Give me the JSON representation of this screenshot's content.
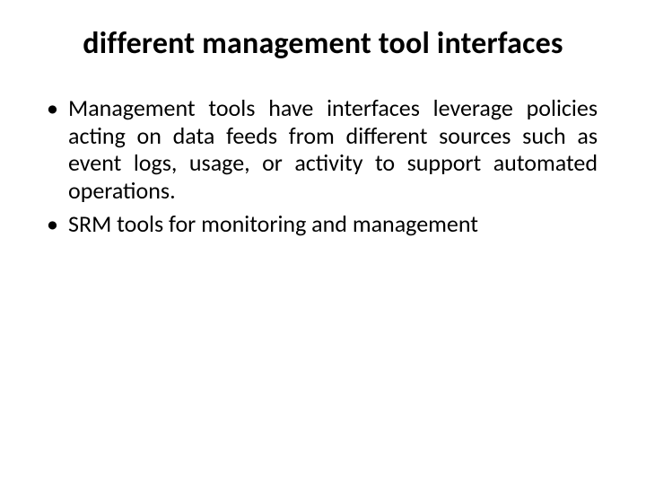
{
  "slide": {
    "title": "different management tool interfaces",
    "bullets": [
      "Management tools have interfaces leverage policies acting on data feeds from different sources such as event logs, usage, or activity to support automated operations.",
      "SRM tools for monitoring and management"
    ]
  }
}
